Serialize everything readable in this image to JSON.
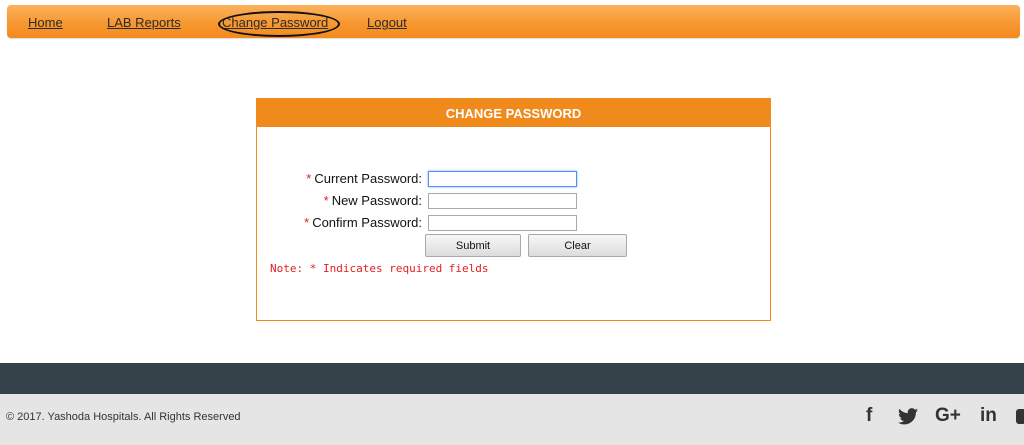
{
  "nav": {
    "items": [
      {
        "label": "Home"
      },
      {
        "label": "LAB Reports"
      },
      {
        "label": "Change Password"
      },
      {
        "label": "Logout"
      }
    ]
  },
  "form": {
    "title": "CHANGE PASSWORD",
    "required_mark": "*",
    "fields": [
      {
        "label": "Current Password:",
        "value": ""
      },
      {
        "label": "New Password:",
        "value": ""
      },
      {
        "label": "Confirm Password:",
        "value": ""
      }
    ],
    "submit_label": "Submit",
    "clear_label": "Clear",
    "note": "Note: * Indicates required fields"
  },
  "footer": {
    "copyright": "© 2017. Yashoda Hospitals. All Rights Reserved",
    "social": [
      {
        "name": "facebook-icon",
        "glyph": "f"
      },
      {
        "name": "twitter-icon",
        "glyph": "🐦"
      },
      {
        "name": "google-plus-icon",
        "glyph": "G+"
      },
      {
        "name": "linkedin-icon",
        "glyph": "in"
      }
    ]
  },
  "colors": {
    "accent": "#f08a1d",
    "required": "#e41e1e",
    "footer_dark": "#36424a"
  }
}
